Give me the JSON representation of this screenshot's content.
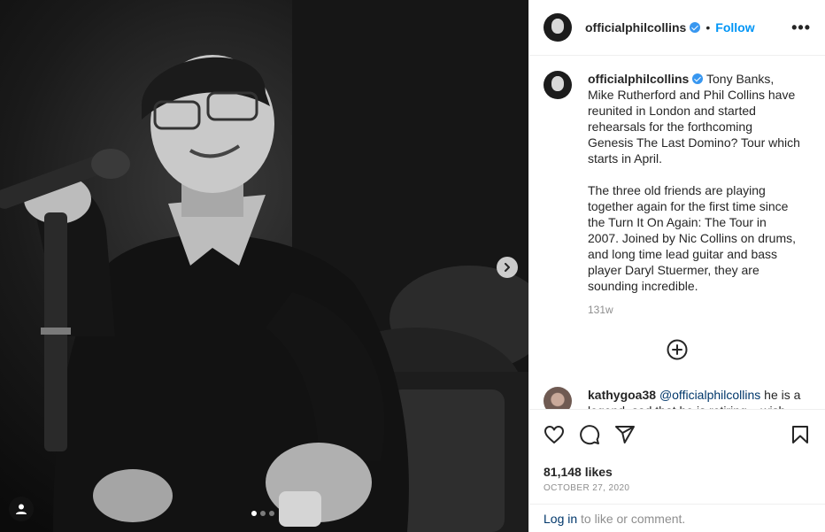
{
  "post": {
    "image_alt": "Black and white photo of Phil Collins smiling with microphone",
    "carousel_dots": 3,
    "active_dot": 0
  },
  "header": {
    "username": "officialphilcollins",
    "separator": "•",
    "follow_label": "Follow",
    "more_label": "•••"
  },
  "caption": {
    "username": "officialphilcollins",
    "paragraph1": "Tony Banks, Mike Rutherford and Phil Collins have reunited in London and started rehearsals for the forthcoming Genesis The Last Domino? Tour which starts in April.",
    "paragraph2": "The three old friends are playing together again for the first time since the Turn It On Again: The Tour in 2007. Joined by Nic Collins on drums, and long time lead guitar and bass player Daryl Stuermer, they are sounding incredible.",
    "time": "131w"
  },
  "comment": {
    "username": "kathygoa38",
    "mention": "@officialphilcollins",
    "text": "he is a legend. sad that he is retiring... wish"
  },
  "stats": {
    "likes": "81,148 likes",
    "date": "OCTOBER 27, 2020"
  },
  "footer": {
    "login_link": "Log in",
    "login_rest": "to like or comment."
  },
  "colors": {
    "accent": "#0095f6",
    "verified": "#3897f0",
    "muted": "#8e8e8e",
    "link": "#00376b"
  }
}
